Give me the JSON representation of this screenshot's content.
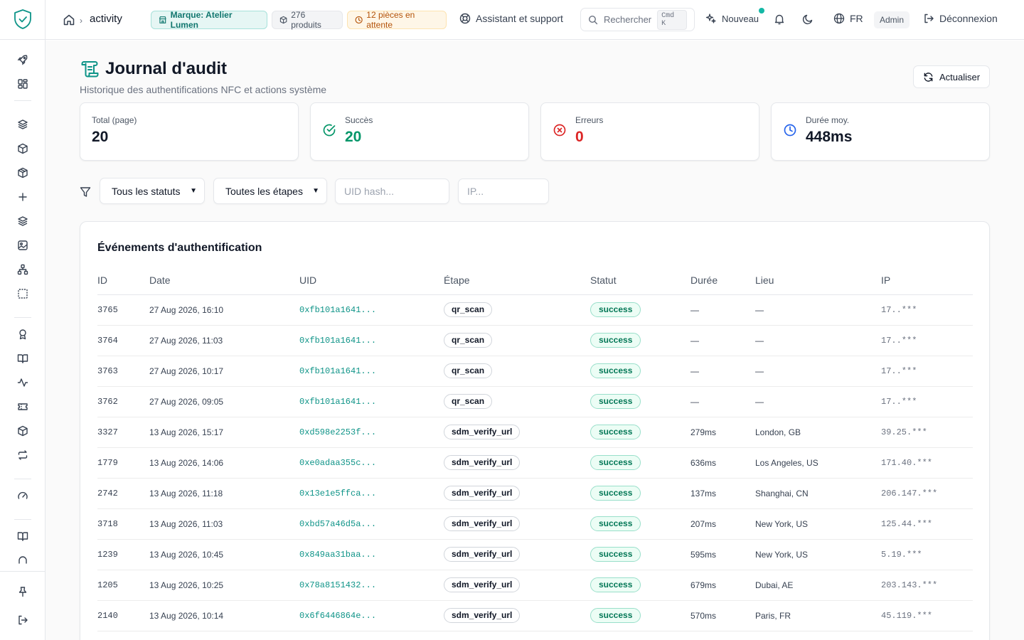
{
  "header": {
    "breadcrumb": "activity",
    "chips": {
      "brand": "Marque: Atelier Lumen",
      "products": "276 produits",
      "pending": "12 pièces en attente"
    },
    "assistant": "Assistant et support",
    "search_placeholder": "Rechercher",
    "search_kbd": "Cmd K",
    "new_label": "Nouveau",
    "language": "FR",
    "role_badge": "Admin",
    "logout": "Déconnexion"
  },
  "page": {
    "title": "Journal d'audit",
    "subtitle": "Historique des authentifications NFC et actions système",
    "refresh_label": "Actualiser"
  },
  "stats": [
    {
      "label": "Total (page)",
      "value": "20",
      "color": "#111827",
      "icon": "none"
    },
    {
      "label": "Succès",
      "value": "20",
      "color": "#059669",
      "icon": "check-circle-icon"
    },
    {
      "label": "Erreurs",
      "value": "0",
      "color": "#dc2626",
      "icon": "x-circle-icon"
    },
    {
      "label": "Durée moy.",
      "value": "448ms",
      "color": "#111827",
      "icon": "clock-icon"
    }
  ],
  "filters": {
    "status_selected": "Tous les statuts",
    "step_selected": "Toutes les étapes",
    "uid_placeholder": "UID hash...",
    "ip_placeholder": "IP..."
  },
  "table": {
    "title": "Événements d'authentification",
    "columns": [
      "ID",
      "Date",
      "UID",
      "Étape",
      "Statut",
      "Durée",
      "Lieu",
      "IP"
    ],
    "rows": [
      {
        "id": "3765",
        "date": "27 Aug 2026, 16:10",
        "uid": "0xfb101a1641...",
        "step": "qr_scan",
        "status": "success",
        "duration": "—",
        "location": "—",
        "ip": "17..***"
      },
      {
        "id": "3764",
        "date": "27 Aug 2026, 11:03",
        "uid": "0xfb101a1641...",
        "step": "qr_scan",
        "status": "success",
        "duration": "—",
        "location": "—",
        "ip": "17..***"
      },
      {
        "id": "3763",
        "date": "27 Aug 2026, 10:17",
        "uid": "0xfb101a1641...",
        "step": "qr_scan",
        "status": "success",
        "duration": "—",
        "location": "—",
        "ip": "17..***"
      },
      {
        "id": "3762",
        "date": "27 Aug 2026, 09:05",
        "uid": "0xfb101a1641...",
        "step": "qr_scan",
        "status": "success",
        "duration": "—",
        "location": "—",
        "ip": "17..***"
      },
      {
        "id": "3327",
        "date": "13 Aug 2026, 15:17",
        "uid": "0xd598e2253f...",
        "step": "sdm_verify_url",
        "status": "success",
        "duration": "279ms",
        "location": "London, GB",
        "ip": "39.25.***"
      },
      {
        "id": "1779",
        "date": "13 Aug 2026, 14:06",
        "uid": "0xe0adaa355c...",
        "step": "sdm_verify_url",
        "status": "success",
        "duration": "636ms",
        "location": "Los Angeles, US",
        "ip": "171.40.***"
      },
      {
        "id": "2742",
        "date": "13 Aug 2026, 11:18",
        "uid": "0x13e1e5ffca...",
        "step": "sdm_verify_url",
        "status": "success",
        "duration": "137ms",
        "location": "Shanghai, CN",
        "ip": "206.147.***"
      },
      {
        "id": "3718",
        "date": "13 Aug 2026, 11:03",
        "uid": "0xbd57a46d5a...",
        "step": "sdm_verify_url",
        "status": "success",
        "duration": "207ms",
        "location": "New York, US",
        "ip": "125.44.***"
      },
      {
        "id": "1239",
        "date": "13 Aug 2026, 10:45",
        "uid": "0x849aa31baa...",
        "step": "sdm_verify_url",
        "status": "success",
        "duration": "595ms",
        "location": "New York, US",
        "ip": "5.19.***"
      },
      {
        "id": "1205",
        "date": "13 Aug 2026, 10:25",
        "uid": "0x78a8151432...",
        "step": "sdm_verify_url",
        "status": "success",
        "duration": "679ms",
        "location": "Dubai, AE",
        "ip": "203.143.***"
      },
      {
        "id": "2140",
        "date": "13 Aug 2026, 10:14",
        "uid": "0x6f6446864e...",
        "step": "sdm_verify_url",
        "status": "success",
        "duration": "570ms",
        "location": "Paris, FR",
        "ip": "45.119.***"
      }
    ]
  }
}
